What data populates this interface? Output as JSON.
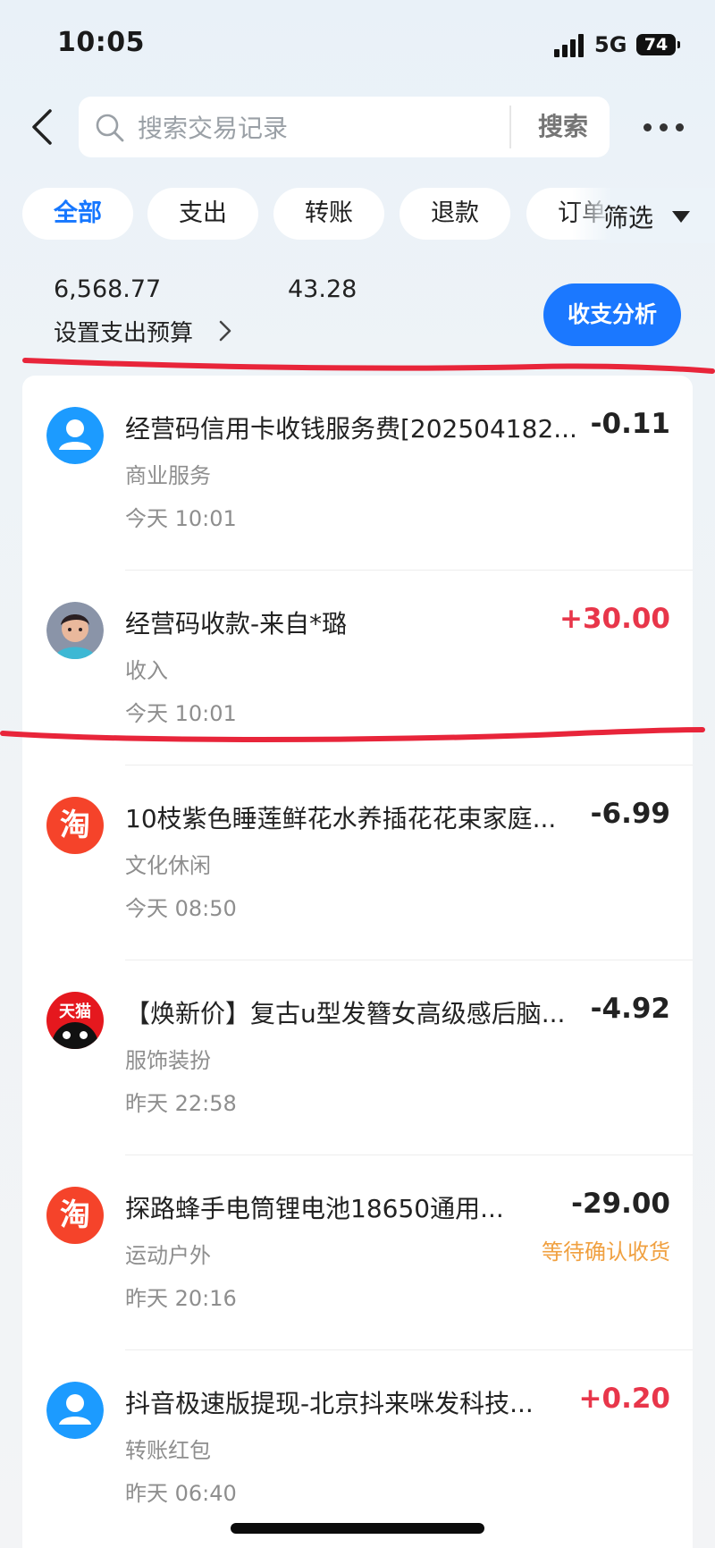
{
  "status_bar": {
    "time": "10:05",
    "network": "5G",
    "battery": "74"
  },
  "search": {
    "placeholder": "搜索交易记录",
    "button": "搜索"
  },
  "tabs": [
    {
      "label": "全部",
      "active": true
    },
    {
      "label": "支出"
    },
    {
      "label": "转账"
    },
    {
      "label": "退款"
    },
    {
      "label": "订单"
    }
  ],
  "filter_label": "筛选",
  "summary": {
    "expense_amount": "6,568.77",
    "income_amount": "43.28",
    "budget_link": "设置支出预算",
    "analysis_button": "收支分析"
  },
  "transactions": [
    {
      "title": "经营码信用卡收钱服务费[202504182...",
      "category": "商业服务",
      "time": "今天 10:01",
      "amount": "-0.11",
      "icon": "user-icon"
    },
    {
      "title": "经营码收款-来自*璐",
      "category": "收入",
      "time": "今天 10:01",
      "amount": "+30.00",
      "icon": "child-photo-avatar"
    },
    {
      "title": "10枝紫色睡莲鲜花水养插花花束家庭...",
      "category": "文化休闲",
      "time": "今天 08:50",
      "amount": "-6.99",
      "icon": "taobao-icon",
      "icon_text": "淘"
    },
    {
      "title": "【焕新价】复古u型发簪女高级感后脑...",
      "category": "服饰装扮",
      "time": "昨天 22:58",
      "amount": "-4.92",
      "icon": "tmall-icon",
      "icon_text": "天猫"
    },
    {
      "title": "探路蜂手电筒锂电池18650通用...",
      "category": "运动户外",
      "time": "昨天 20:16",
      "amount": "-29.00",
      "status": "等待确认收货",
      "icon": "taobao-icon",
      "icon_text": "淘"
    },
    {
      "title": "抖音极速版提现-北京抖来咪发科技...",
      "category": "转账红包",
      "time": "昨天 06:40",
      "amount": "+0.20",
      "icon": "user-icon"
    }
  ],
  "colors": {
    "accent_blue": "#1677ff",
    "income_red": "#e8364a",
    "status_orange": "#f0a040",
    "annotation_red": "#e8253a",
    "taobao_red": "#f5432a",
    "tmall_red": "#e5181e"
  }
}
